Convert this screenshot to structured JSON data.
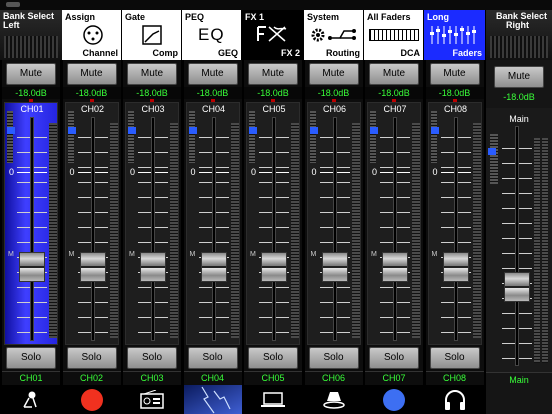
{
  "top_tabs": [
    {
      "id": "assign",
      "top": "Assign",
      "bottom": "Channel",
      "icon": "xlr-connector-icon"
    },
    {
      "id": "gate",
      "top": "Gate",
      "bottom": "Comp",
      "icon": "compressor-curve-icon"
    },
    {
      "id": "peq",
      "top": "PEQ",
      "bottom": "GEQ",
      "icon": "eq-icon",
      "icon_text": "EQ"
    },
    {
      "id": "fx",
      "top": "FX 1",
      "bottom": "FX 2",
      "icon": "fx-icon"
    },
    {
      "id": "system",
      "top": "System",
      "bottom": "Routing",
      "icon": "gear-routing-icon"
    },
    {
      "id": "allfaders",
      "top": "All Faders",
      "bottom": "DCA",
      "icon": "fader-bank-icon"
    },
    {
      "id": "long",
      "top": "Long",
      "bottom": "Faders",
      "icon": "long-faders-icon",
      "active": true
    }
  ],
  "bank_left": {
    "line1": "Bank Select",
    "line2": "Left"
  },
  "bank_right": {
    "line1": "Bank Select",
    "line2": "Right"
  },
  "channels": [
    {
      "name": "CH01",
      "label": "CH01",
      "mute": "Mute",
      "solo": "Solo",
      "db": "-18.0dB",
      "fader_level": 0.33,
      "selected": true,
      "icon": "microphone-stand-icon"
    },
    {
      "name": "CH02",
      "label": "CH02",
      "mute": "Mute",
      "solo": "Solo",
      "db": "-18.0dB",
      "fader_level": 0.33,
      "icon": "red-circle-icon"
    },
    {
      "name": "CH03",
      "label": "CH03",
      "mute": "Mute",
      "solo": "Solo",
      "db": "-18.0dB",
      "fader_level": 0.33,
      "icon": "radio-icon"
    },
    {
      "name": "CH04",
      "label": "CH04",
      "mute": "Mute",
      "solo": "Solo",
      "db": "-18.0dB",
      "fader_level": 0.33,
      "icon": "lightning-image-icon"
    },
    {
      "name": "CH05",
      "label": "CH05",
      "mute": "Mute",
      "solo": "Solo",
      "db": "-18.0dB",
      "fader_level": 0.33,
      "icon": "laptop-icon"
    },
    {
      "name": "CH06",
      "label": "CH06",
      "mute": "Mute",
      "solo": "Solo",
      "db": "-18.0dB",
      "fader_level": 0.33,
      "icon": "conference-speaker-icon"
    },
    {
      "name": "CH07",
      "label": "CH07",
      "mute": "Mute",
      "solo": "Solo",
      "db": "-18.0dB",
      "fader_level": 0.33,
      "icon": "blue-circle-icon"
    },
    {
      "name": "CH08",
      "label": "CH08",
      "mute": "Mute",
      "solo": "Solo",
      "db": "-18.0dB",
      "fader_level": 0.33,
      "icon": "headphones-icon"
    }
  ],
  "main": {
    "name": "Main",
    "label": "Main",
    "mute": "Mute",
    "db": "-18.0dB",
    "fader_level": 0.33
  },
  "scale": {
    "zero": "0",
    "m": "M"
  },
  "colors": {
    "accent": "#1b2bff",
    "level_text": "#39ff39",
    "selected_strip": "#3f3fff"
  }
}
